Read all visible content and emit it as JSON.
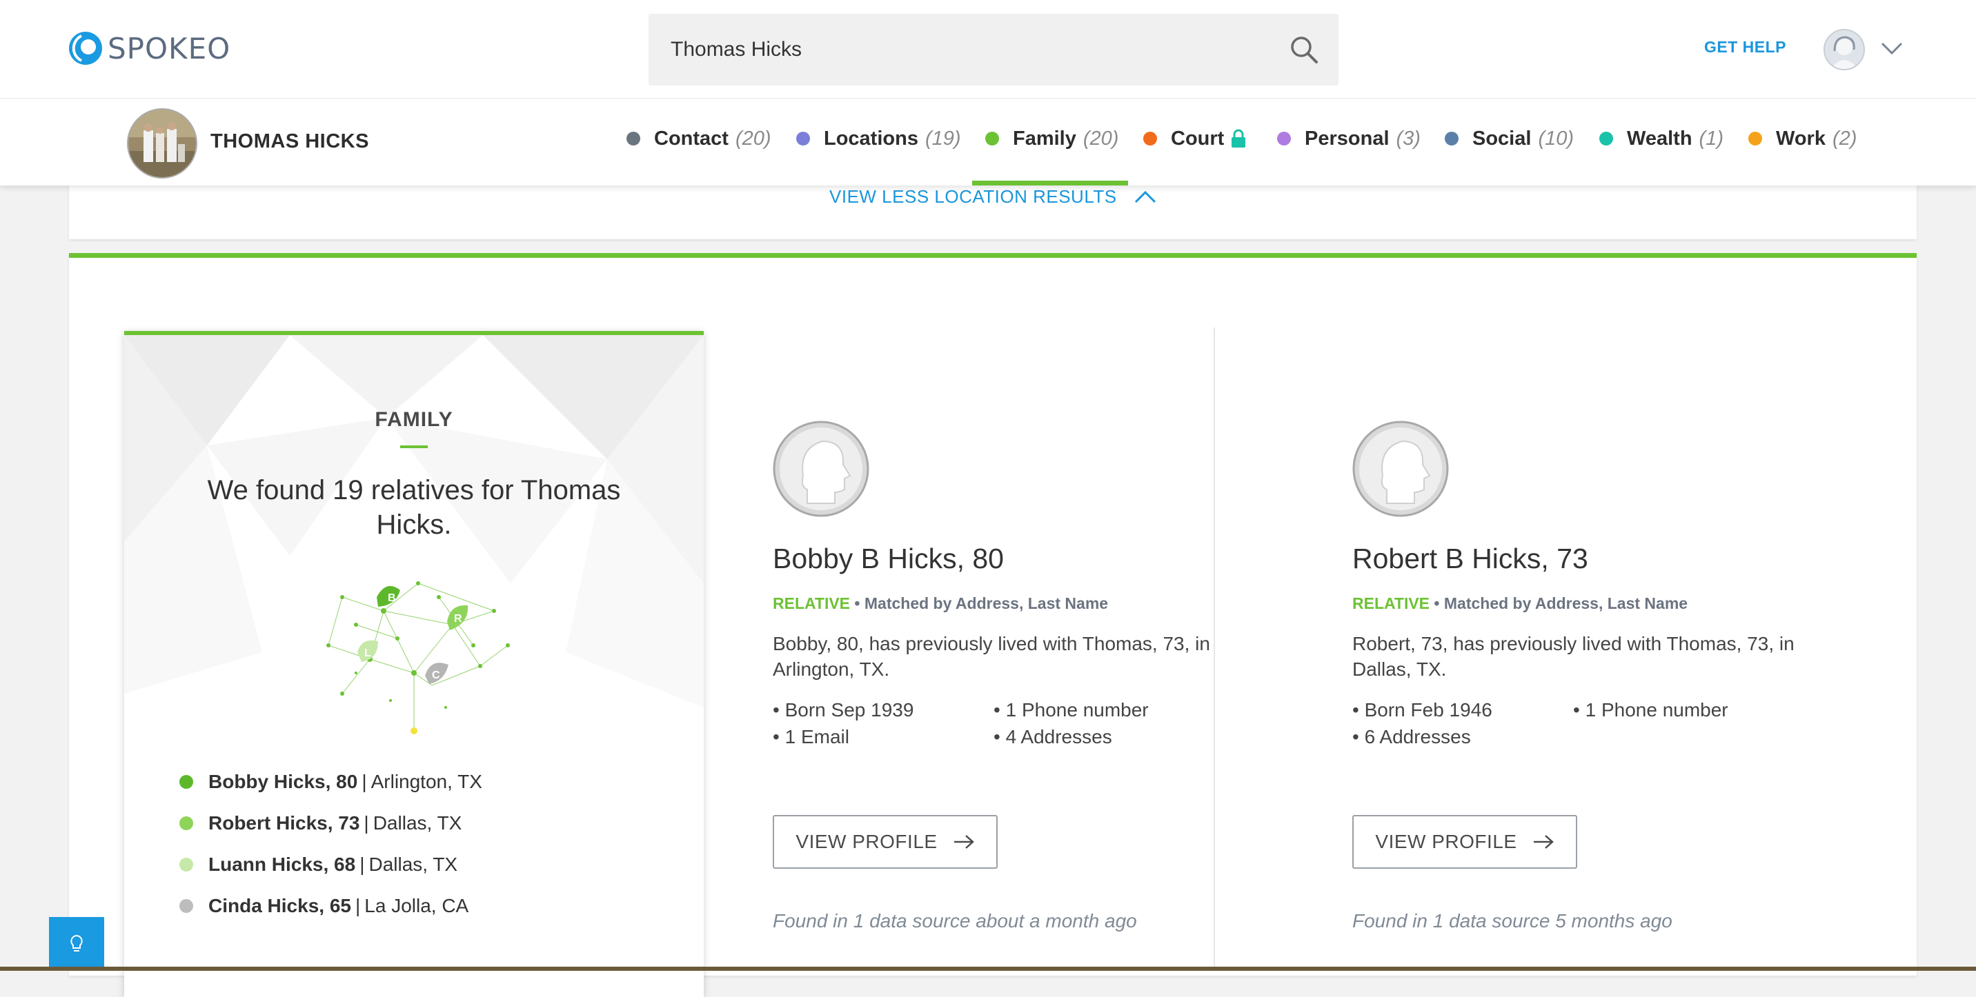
{
  "header": {
    "logo_text": "SPOKEO",
    "search_value": "Thomas Hicks",
    "get_help": "GET HELP"
  },
  "profile": {
    "name": "THOMAS HICKS"
  },
  "tabs": [
    {
      "label": "Contact",
      "count": "(20)",
      "color": "#6b7580"
    },
    {
      "label": "Locations",
      "count": "(19)",
      "color": "#7b7fd9"
    },
    {
      "label": "Family",
      "count": "(20)",
      "color": "#6cc233"
    },
    {
      "label": "Court",
      "count": "",
      "color": "#f26a1b"
    },
    {
      "label": "Personal",
      "count": "(3)",
      "color": "#b07be0"
    },
    {
      "label": "Social",
      "count": "(10)",
      "color": "#5a7fa8"
    },
    {
      "label": "Wealth",
      "count": "(1)",
      "color": "#19c2a8"
    },
    {
      "label": "Work",
      "count": "(2)",
      "color": "#f5a21b"
    }
  ],
  "locations": {
    "view_less": "VIEW LESS LOCATION RESULTS"
  },
  "family": {
    "title": "FAMILY",
    "summary": "We found 19 relatives for Thomas Hicks.",
    "tree_letters": [
      "B",
      "R",
      "L",
      "C"
    ],
    "relatives_list": [
      {
        "name": "Bobby Hicks, 80",
        "location": "Arlington, TX",
        "color": "#5cb82a"
      },
      {
        "name": "Robert Hicks, 73",
        "location": "Dallas, TX",
        "color": "#8fd45a"
      },
      {
        "name": "Luann Hicks, 68",
        "location": "Dallas, TX",
        "color": "#c6e8a8"
      },
      {
        "name": "Cinda Hicks, 65",
        "location": "La Jolla, CA",
        "color": "#bdbdbd"
      }
    ],
    "separator": "|"
  },
  "relatives": [
    {
      "name": "Bobby B Hicks, 80",
      "tag": "RELATIVE",
      "match": "Matched by Address, Last Name",
      "desc": "Bobby, 80, has previously lived with Thomas, 73, in Arlington, TX.",
      "facts": [
        "Born Sep 1939",
        "1 Phone number",
        "1 Email",
        "4 Addresses"
      ],
      "button": "VIEW PROFILE",
      "found": "Found in 1 data source about a month ago"
    },
    {
      "name": "Robert B Hicks, 73",
      "tag": "RELATIVE",
      "match": "Matched by Address, Last Name",
      "desc": "Robert, 73, has previously lived with Thomas, 73, in Dallas, TX.",
      "facts": [
        "Born Feb 1946",
        "1 Phone number",
        "6 Addresses"
      ],
      "button": "VIEW PROFILE",
      "found": "Found in 1 data source 5 months ago"
    }
  ]
}
